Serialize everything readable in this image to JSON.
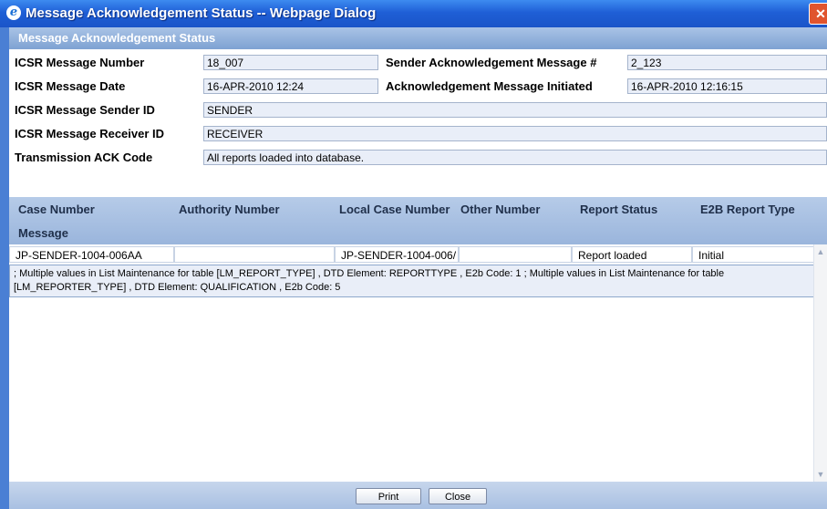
{
  "window": {
    "title": "Message Acknowledgement Status -- Webpage Dialog",
    "close_glyph": "✕"
  },
  "section": {
    "title": "Message Acknowledgement Status"
  },
  "fields": {
    "icsr_message_number": {
      "label": "ICSR Message Number",
      "value": "18_007"
    },
    "sender_ack_message": {
      "label": "Sender Acknowledgement Message #",
      "value": "2_123"
    },
    "icsr_message_date": {
      "label": "ICSR Message Date",
      "value": "16-APR-2010 12:24"
    },
    "ack_message_initiated": {
      "label": "Acknowledgement Message Initiated",
      "value": "16-APR-2010 12:16:15"
    },
    "icsr_sender_id": {
      "label": "ICSR Message Sender ID",
      "value": "SENDER"
    },
    "icsr_receiver_id": {
      "label": "ICSR Message Receiver ID",
      "value": "RECEIVER"
    },
    "transmission_ack_code": {
      "label": "Transmission ACK Code",
      "value": "All reports loaded into database."
    }
  },
  "grid": {
    "columns": [
      "Case Number",
      "Authority Number",
      "Local Case Number",
      "Other Number",
      "Report Status",
      "E2B Report Type"
    ],
    "second_header": "Message",
    "rows": [
      {
        "case_number": "JP-SENDER-1004-006AA",
        "authority_number": "",
        "local_case_number": "JP-SENDER-1004-006/",
        "other_number": "",
        "report_status": "Report loaded",
        "e2b_report_type": "Initial",
        "message": "; Multiple values in List Maintenance for table [LM_REPORT_TYPE] , DTD Element: REPORTTYPE , E2b Code: 1 ; Multiple values in List Maintenance for table [LM_REPORTER_TYPE] , DTD Element: QUALIFICATION , E2b Code: 5"
      }
    ]
  },
  "footer": {
    "print_label": "Print",
    "close_label": "Close"
  },
  "icons": {
    "title": "ie-icon",
    "scroll_up": "scroll-up-icon",
    "scroll_down": "scroll-down-icon"
  },
  "colors": {
    "titlebar": "#1f5fd6",
    "header": "#7ea2d2",
    "field_bg": "#e9eef8"
  }
}
